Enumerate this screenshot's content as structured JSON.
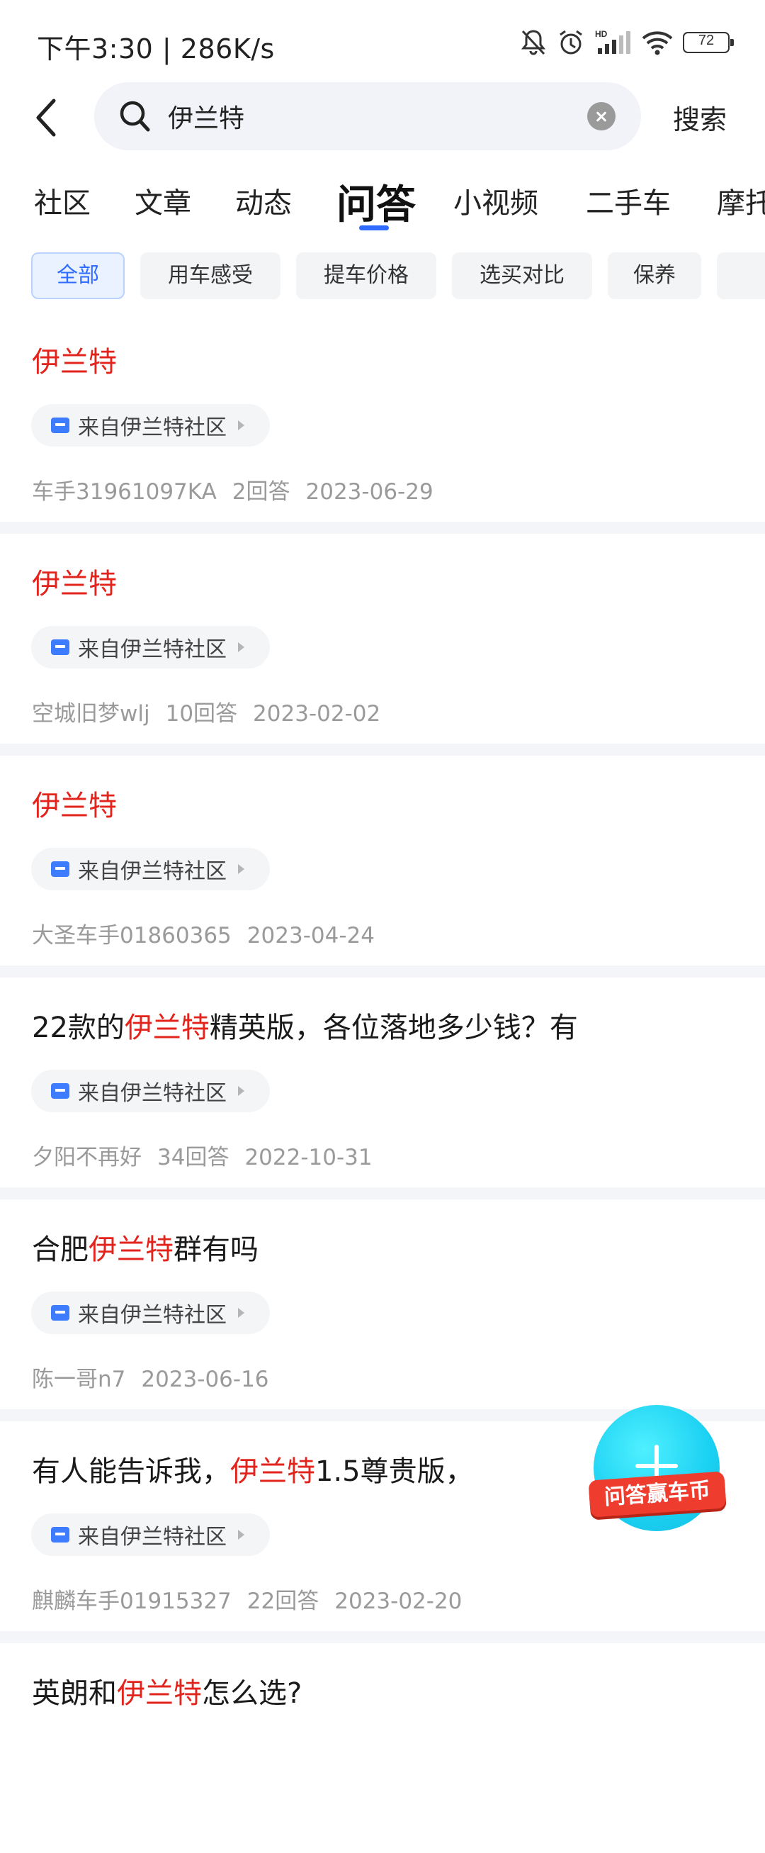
{
  "status_bar": {
    "time": "下午3:30 | 286K/s",
    "battery": "72",
    "icons": [
      "mute-bell-icon",
      "alarm-icon",
      "hd-signal-icon",
      "wifi-icon",
      "battery-icon"
    ]
  },
  "search": {
    "query": "伊兰特",
    "submit_label": "搜索"
  },
  "tabs": [
    {
      "label": "社区",
      "active": false
    },
    {
      "label": "文章",
      "active": false
    },
    {
      "label": "动态",
      "active": false
    },
    {
      "label": "问答",
      "active": true
    },
    {
      "label": "小视频",
      "active": false
    },
    {
      "label": "二手车",
      "active": false
    },
    {
      "label": "摩托",
      "active": false
    }
  ],
  "filters": [
    {
      "label": "全部",
      "active": true
    },
    {
      "label": "用车感受",
      "active": false
    },
    {
      "label": "提车价格",
      "active": false
    },
    {
      "label": "选买对比",
      "active": false
    },
    {
      "label": "保养",
      "active": false
    }
  ],
  "colors": {
    "highlight": "#e3241c",
    "accent": "#2f6bff",
    "fab": "#1ad0f2",
    "fab_ribbon": "#ee3d2f"
  },
  "items": [
    {
      "title_pre": "",
      "title_hl": "伊兰特",
      "title_post": "",
      "community": "来自伊兰特社区",
      "author": "车手31961097KA",
      "answers": "2回答",
      "date": "2023-06-29"
    },
    {
      "title_pre": "",
      "title_hl": "伊兰特",
      "title_post": "",
      "community": "来自伊兰特社区",
      "author": "空城旧梦wlj",
      "answers": "10回答",
      "date": "2023-02-02"
    },
    {
      "title_pre": "",
      "title_hl": "伊兰特",
      "title_post": "",
      "community": "来自伊兰特社区",
      "author": "大圣车手01860365",
      "answers": "",
      "date": "2023-04-24"
    },
    {
      "title_pre": "22款的",
      "title_hl": "伊兰特",
      "title_post": "精英版，各位落地多少钱？有",
      "community": "来自伊兰特社区",
      "author": "夕阳不再好",
      "answers": "34回答",
      "date": "2022-10-31"
    },
    {
      "title_pre": "合肥",
      "title_hl": "伊兰特",
      "title_post": "群有吗",
      "community": "来自伊兰特社区",
      "author": "陈一哥n7",
      "answers": "",
      "date": "2023-06-16"
    },
    {
      "title_pre": "有人能告诉我，",
      "title_hl": "伊兰特",
      "title_post": "1.5尊贵版，",
      "community": "来自伊兰特社区",
      "author": "麒麟车手01915327",
      "answers": "22回答",
      "date": "2023-02-20"
    },
    {
      "title_pre": "英朗和",
      "title_hl": "伊兰特",
      "title_post": "怎么选?",
      "community": "",
      "author": "",
      "answers": "",
      "date": ""
    }
  ],
  "fab": {
    "label": "问答赢车币"
  }
}
